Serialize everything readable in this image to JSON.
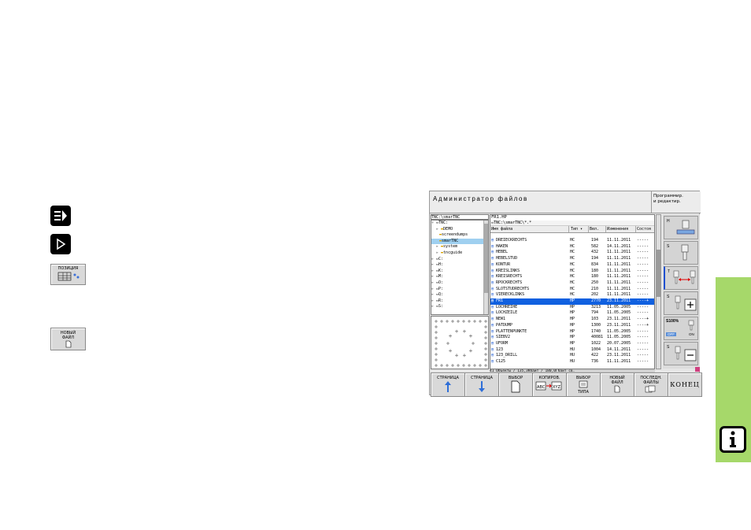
{
  "left_panel": {
    "key1_icon": "program-run-icon",
    "key2_icon": "play-icon",
    "softkey_position": "ПОЗИЦИЯ",
    "softkey_new_file_line1": "НОВЫЙ",
    "softkey_new_file_line2": "ФАЙЛ"
  },
  "screen": {
    "title": "Администратор файлов",
    "mode_line1": "Программир.",
    "mode_line2": "и редактир.",
    "tree_path": "TNC:\\smarTNC",
    "tree_items": [
      "TNC:",
      "DEMO",
      "screendumps",
      "smarTNC",
      "system",
      "tncguide",
      "C:",
      "H:",
      "K:",
      "M:",
      "O:",
      "P:",
      "Q:",
      "R:",
      "S:"
    ],
    "list_filename": "FR1.HP",
    "list_path": "TNC:\\smarTNC\\*.*",
    "columns": [
      "Имя файла",
      "Тип",
      "Вел.",
      "Изменения",
      "Состоя"
    ],
    "files": [
      {
        "name": "DREIECKRECHTS",
        "type": "HC",
        "size": "194",
        "date": "11.11.2011",
        "state": "-----"
      },
      {
        "name": "HAKEN",
        "type": "HC",
        "size": "582",
        "date": "14.11.2011",
        "state": "-----"
      },
      {
        "name": "HEBEL",
        "type": "HC",
        "size": "432",
        "date": "11.11.2011",
        "state": "-----"
      },
      {
        "name": "HEBELSTUD",
        "type": "HC",
        "size": "194",
        "date": "11.11.2011",
        "state": "-----"
      },
      {
        "name": "KONTUR",
        "type": "HC",
        "size": "834",
        "date": "11.11.2011",
        "state": "-----"
      },
      {
        "name": "KREISLINKS",
        "type": "HC",
        "size": "180",
        "date": "11.11.2011",
        "state": "-----"
      },
      {
        "name": "KREISRECHTS",
        "type": "HC",
        "size": "180",
        "date": "11.11.2011",
        "state": "-----"
      },
      {
        "name": "RPOCKRECHTS",
        "type": "HC",
        "size": "250",
        "date": "11.11.2011",
        "state": "-----"
      },
      {
        "name": "SLOTSTUDRECHTS",
        "type": "HC",
        "size": "210",
        "date": "11.11.2011",
        "state": "-----"
      },
      {
        "name": "VIERECKLINKS",
        "type": "HC",
        "size": "202",
        "date": "11.11.2011",
        "state": "-----"
      },
      {
        "name": "FR1",
        "type": "HP",
        "size": "2770",
        "date": "23.11.2011",
        "state": "----+"
      },
      {
        "name": "LOCHREIHE",
        "type": "HP",
        "size": "3213",
        "date": "11.05.2005",
        "state": "-----"
      },
      {
        "name": "LOCHZEILE",
        "type": "HP",
        "size": "794",
        "date": "11.05.2005",
        "state": "-----"
      },
      {
        "name": "NEW1",
        "type": "HP",
        "size": "103",
        "date": "23.11.2011",
        "state": "----+"
      },
      {
        "name": "PATDUMP",
        "type": "HP",
        "size": "1300",
        "date": "23.11.2011",
        "state": "----+"
      },
      {
        "name": "PLATTENPUNKTE",
        "type": "HP",
        "size": "1740",
        "date": "11.05.2005",
        "state": "-----"
      },
      {
        "name": "SIEBV2",
        "type": "HP",
        "size": "40081",
        "date": "11.05.2005",
        "state": "-----"
      },
      {
        "name": "UFORM",
        "type": "HP",
        "size": "1022",
        "date": "20.07.2005",
        "state": "-----"
      },
      {
        "name": "123",
        "type": "HU",
        "size": "1004",
        "date": "14.11.2011",
        "state": "-----"
      },
      {
        "name": "123_DRILL",
        "type": "HU",
        "size": "422",
        "date": "23.11.2011",
        "state": "-----"
      },
      {
        "name": "C125",
        "type": "HU",
        "size": "736",
        "date": "11.11.2011",
        "state": "-----"
      }
    ],
    "status": "41 Объекты / 135,3Кбайт / 180,0Гбайт св.",
    "side_labels": {
      "h": "H",
      "s1": "S",
      "t": "T",
      "s2": "S",
      "feed": "S100%",
      "off": "OFF",
      "on": "ON",
      "s3": "S"
    },
    "softkeys": [
      {
        "label1": "СТРАНИЦА",
        "label2": ""
      },
      {
        "label1": "СТРАНИЦА",
        "label2": ""
      },
      {
        "label1": "ВЫБОР",
        "label2": ""
      },
      {
        "label1": "КОПИРОВ.",
        "label2": ""
      },
      {
        "label1": "ВЫБОР",
        "label2": "ТИПА"
      },
      {
        "label1": "НОВЫЙ",
        "label2": "ФАЙЛ"
      },
      {
        "label1": "ПОСЛЕДН.",
        "label2": "ФАЙЛЫ"
      },
      {
        "label1": "КОНЕЦ",
        "label2": ""
      }
    ]
  },
  "info_icon": "info-icon",
  "colors": {
    "selection": "#1060e0",
    "info_bar": "#a6d86a"
  }
}
